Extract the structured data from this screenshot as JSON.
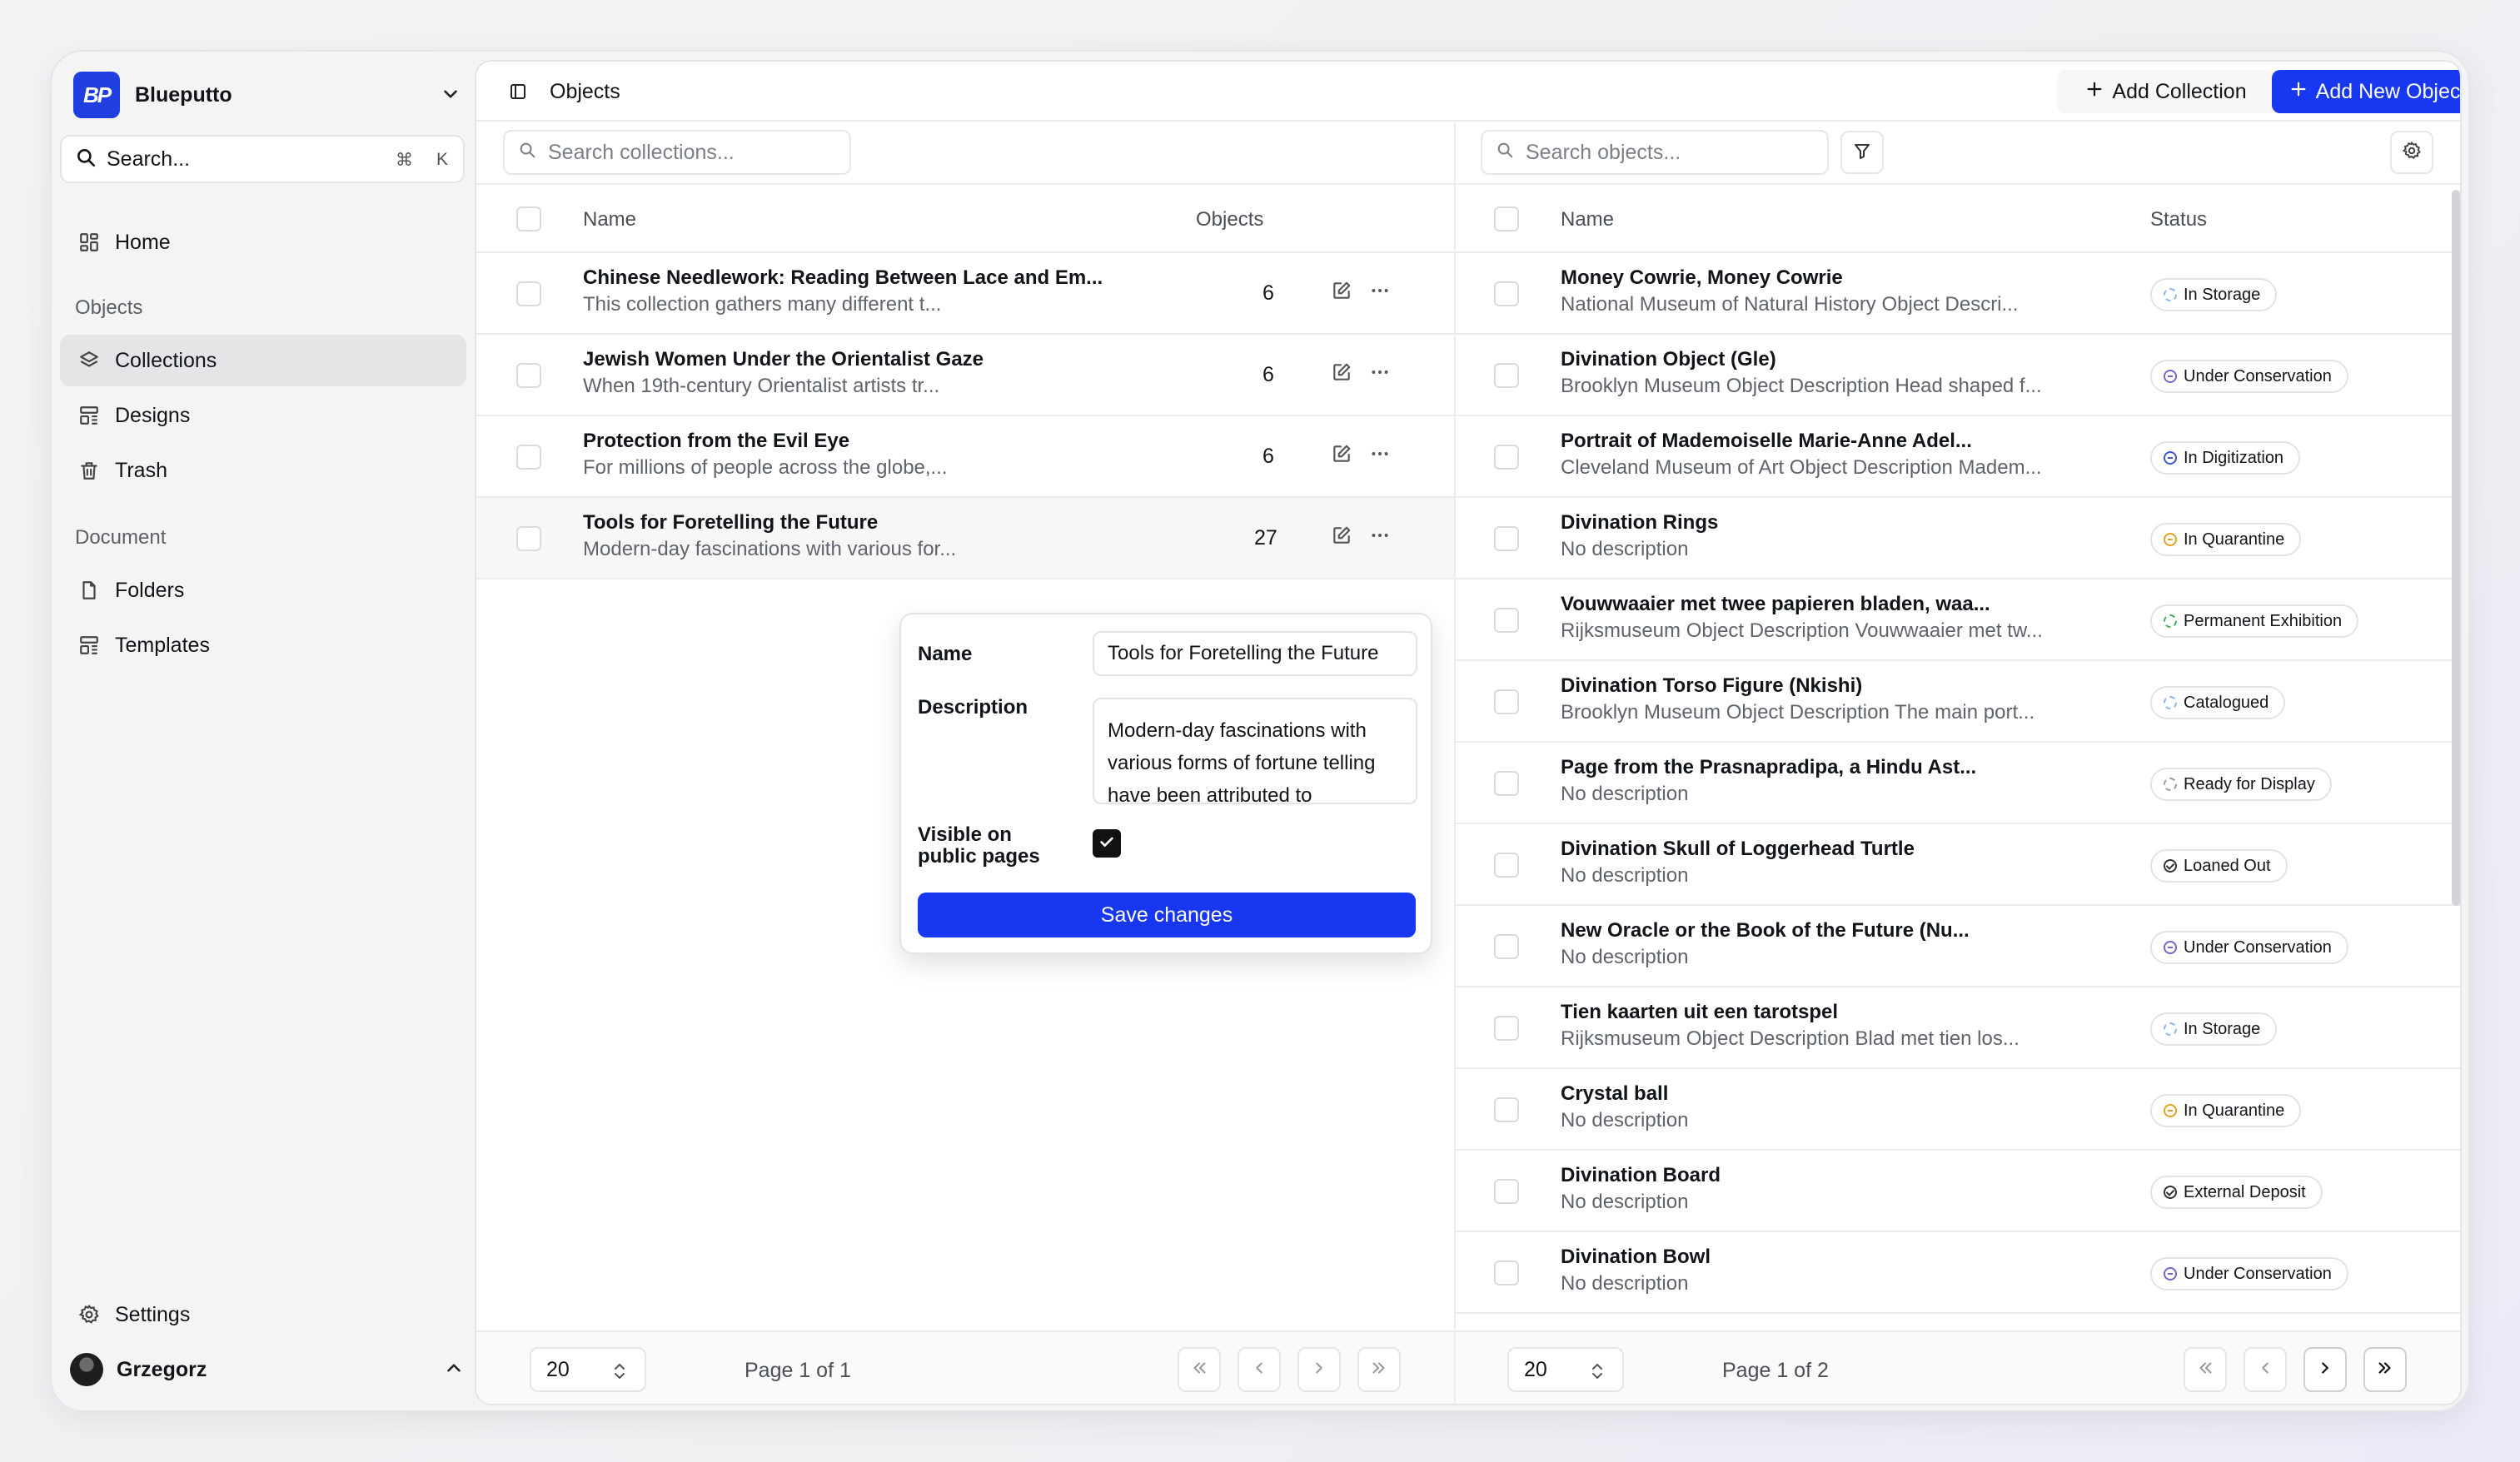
{
  "sidebar": {
    "brand": "Blueputto",
    "logo_text": "BP",
    "search_label": "Search...",
    "shortcut_cmd": "⌘",
    "shortcut_key": "K",
    "home": "Home",
    "objects_section": "Objects",
    "collections": "Collections",
    "designs": "Designs",
    "trash": "Trash",
    "document_section": "Document",
    "folders": "Folders",
    "templates": "Templates",
    "settings": "Settings",
    "user": "Grzegorz"
  },
  "header": {
    "title": "Objects",
    "add_collection": "Add Collection",
    "add_object": "Add New Object"
  },
  "collections_pane": {
    "search_placeholder": "Search collections...",
    "col_name": "Name",
    "col_objects": "Objects",
    "rows": [
      {
        "title": "Chinese Needlework: Reading Between Lace and Em...",
        "desc": "This collection gathers many different t...",
        "count": "6"
      },
      {
        "title": "Jewish Women Under the Orientalist Gaze",
        "desc": "When 19th-century Orientalist artists tr...",
        "count": "6"
      },
      {
        "title": "Protection from the Evil Eye",
        "desc": "For millions of people across the globe,...",
        "count": "6"
      },
      {
        "title": "Tools for Foretelling the Future",
        "desc": "Modern-day fascinations with various for...",
        "count": "27"
      }
    ],
    "page_size": "20",
    "page_info": "Page 1 of 1"
  },
  "popover": {
    "name_label": "Name",
    "name_value": "Tools for Foretelling the Future",
    "description_label": "Description",
    "description_value": "Modern-day fascinations with various forms of fortune telling have been attributed to",
    "visible_label_1": "Visible on",
    "visible_label_2": "public pages",
    "visible_checked": true,
    "save": "Save changes"
  },
  "objects_pane": {
    "search_placeholder": "Search objects...",
    "col_name": "Name",
    "col_status": "Status",
    "rows": [
      {
        "title": "Money Cowrie, Money Cowrie",
        "desc": "National Museum of Natural History Object Descri...",
        "status": "In Storage",
        "status_color": "#8fb3e8",
        "dot": "dashed"
      },
      {
        "title": "Divination Object (Gle)",
        "desc": "Brooklyn Museum Object Description Head shaped f...",
        "status": "Under Conservation",
        "status_color": "#7a63c9",
        "dot": "minus"
      },
      {
        "title": "Portrait of Mademoiselle Marie-Anne Adel...",
        "desc": "Cleveland Museum of Art Object Description Madem...",
        "status": "In Digitization",
        "status_color": "#3d56c9",
        "dot": "minus"
      },
      {
        "title": "Divination Rings",
        "desc": "No description",
        "status": "In Quarantine",
        "status_color": "#e0a21f",
        "dot": "minus"
      },
      {
        "title": "Vouwwaaier met twee papieren bladen, waa...",
        "desc": "Rijksmuseum Object Description Vouwwaaier met tw...",
        "status": "Permanent Exhibition",
        "status_color": "#3fae5a",
        "dot": "dashed"
      },
      {
        "title": "Divination Torso Figure (Nkishi)",
        "desc": "Brooklyn Museum Object Description The main port...",
        "status": "Catalogued",
        "status_color": "#8fb3e8",
        "dot": "dashed"
      },
      {
        "title": "Page from the Prasnapradipa, a Hindu Ast...",
        "desc": "No description",
        "status": "Ready for Display",
        "status_color": "#9a9a9a",
        "dot": "dashed"
      },
      {
        "title": "Divination Skull of Loggerhead Turtle",
        "desc": "No description",
        "status": "Loaned Out",
        "status_color": "#333333",
        "dot": "check"
      },
      {
        "title": "New Oracle or the Book of the Future (Nu...",
        "desc": "No description",
        "status": "Under Conservation",
        "status_color": "#7a63c9",
        "dot": "minus"
      },
      {
        "title": "Tien kaarten uit een tarotspel",
        "desc": "Rijksmuseum Object Description Blad met tien los...",
        "status": "In Storage",
        "status_color": "#8fb3e8",
        "dot": "dashed"
      },
      {
        "title": "Crystal ball",
        "desc": "No description",
        "status": "In Quarantine",
        "status_color": "#e0a21f",
        "dot": "minus"
      },
      {
        "title": "Divination Board",
        "desc": "No description",
        "status": "External Deposit",
        "status_color": "#333333",
        "dot": "check"
      },
      {
        "title": "Divination Bowl",
        "desc": "No description",
        "status": "Under Conservation",
        "status_color": "#7a63c9",
        "dot": "minus"
      }
    ],
    "page_size": "20",
    "page_info": "Page 1 of 2"
  },
  "colors": {
    "accent": "#1737f0",
    "brand": "#1f3fe0"
  }
}
